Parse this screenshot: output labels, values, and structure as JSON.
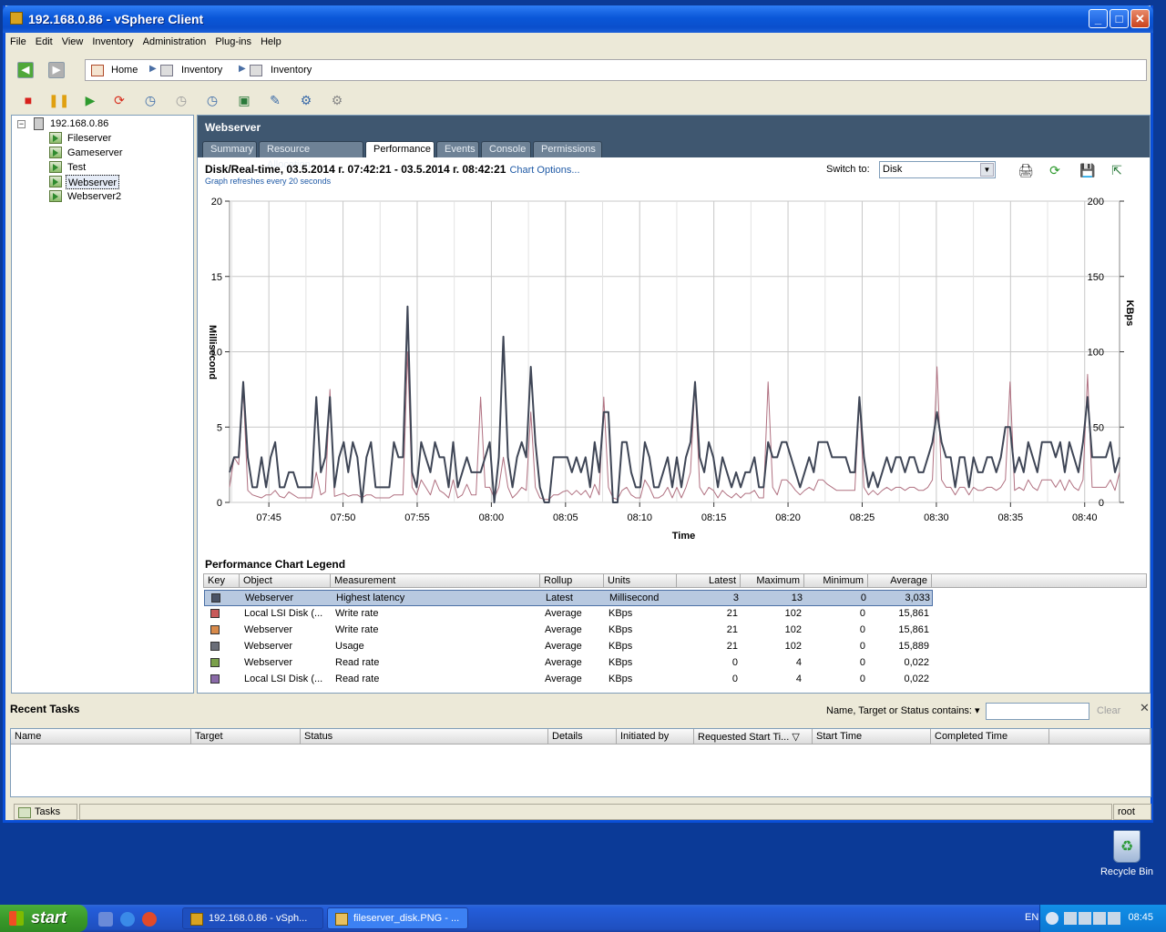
{
  "window": {
    "title": "192.168.0.86 - vSphere Client",
    "min": "_",
    "max": "□",
    "close": "✕"
  },
  "menu": [
    "File",
    "Edit",
    "View",
    "Inventory",
    "Administration",
    "Plug-ins",
    "Help"
  ],
  "breadcrumb": [
    "Home",
    "Inventory",
    "Inventory"
  ],
  "tree": {
    "host": "192.168.0.86",
    "expander": "−",
    "vms": [
      "Fileserver",
      "Gameserver",
      "Test",
      "Webserver",
      "Webserver2"
    ],
    "selected": "Webserver"
  },
  "main": {
    "title": "Webserver",
    "tabs": [
      "Summary",
      "Resource Allocation",
      "Performance",
      "Events",
      "Console",
      "Permissions"
    ],
    "active_tab": "Performance"
  },
  "chart_header": {
    "title": "Disk/Real-time, 03.5.2014 г. 07:42:21 - 03.5.2014 г. 08:42:21",
    "options_link": "Chart Options...",
    "refresh_note": "Graph refreshes every 20 seconds",
    "switch_label": "Switch to:",
    "switch_value": "Disk",
    "switch_arrow": "▼"
  },
  "header_icons": [
    "🖨",
    "⟳",
    "💾",
    "⇱"
  ],
  "chart_data": {
    "type": "line",
    "xlabel": "Time",
    "ylabel_left": "Millisecond",
    "ylabel_right": "KBps",
    "x_ticks": [
      "07:45",
      "07:50",
      "07:55",
      "08:00",
      "08:05",
      "08:10",
      "08:15",
      "08:20",
      "08:25",
      "08:30",
      "08:35",
      "08:40"
    ],
    "y_left_ticks": [
      "0",
      "5",
      "10",
      "15",
      "20"
    ],
    "y_right_ticks": [
      "0",
      "50",
      "100",
      "150",
      "200"
    ],
    "ylim_left": [
      0,
      20
    ],
    "ylim_right": [
      0,
      200
    ],
    "grid": true,
    "series": [
      {
        "name": "Highest latency",
        "axis": "left",
        "color": "#3f4656",
        "values": [
          2,
          3,
          3,
          8,
          3,
          1,
          1,
          3,
          1,
          3,
          4,
          1,
          1,
          2,
          2,
          1,
          1,
          1,
          1,
          7,
          2,
          3,
          7,
          1,
          3,
          4,
          2,
          4,
          3,
          0,
          3,
          4,
          1,
          1,
          1,
          1,
          4,
          3,
          3,
          13,
          2,
          1,
          4,
          3,
          2,
          4,
          3,
          3,
          1,
          4,
          1,
          2,
          3,
          2,
          2,
          2,
          3,
          4,
          0,
          3,
          11,
          3,
          1,
          3,
          4,
          3,
          9,
          4,
          1,
          0,
          0,
          3,
          3,
          3,
          3,
          2,
          3,
          2,
          3,
          1,
          4,
          2,
          6,
          6,
          0,
          0,
          4,
          4,
          2,
          1,
          1,
          4,
          3,
          1,
          1,
          2,
          3,
          1,
          3,
          1,
          3,
          4,
          8,
          3,
          2,
          4,
          3,
          1,
          3,
          2,
          1,
          2,
          1,
          2,
          2,
          3,
          1,
          1,
          4,
          3,
          3,
          4,
          4,
          3,
          2,
          1,
          2,
          3,
          2,
          4,
          4,
          4,
          3,
          3,
          3,
          3,
          2,
          2,
          7,
          3,
          1,
          2,
          1,
          2,
          3,
          2,
          3,
          3,
          2,
          3,
          3,
          2,
          2,
          3,
          4,
          6,
          4,
          3,
          3,
          1,
          3,
          3,
          1,
          3,
          2,
          2,
          3,
          3,
          2,
          3,
          5,
          5,
          2,
          3,
          2,
          4,
          3,
          2,
          4,
          4,
          4,
          3,
          4,
          2,
          4,
          3,
          2,
          4,
          7,
          3,
          3,
          3,
          3,
          4,
          2,
          3
        ]
      },
      {
        "name": "Write rate",
        "axis": "right",
        "color": "#b07080",
        "values": [
          10,
          30,
          25,
          75,
          8,
          5,
          4,
          3,
          5,
          5,
          8,
          4,
          3,
          7,
          5,
          3,
          3,
          3,
          3,
          20,
          5,
          7,
          75,
          4,
          5,
          6,
          4,
          5,
          5,
          3,
          5,
          5,
          3,
          3,
          3,
          3,
          5,
          5,
          5,
          100,
          10,
          5,
          15,
          10,
          5,
          15,
          8,
          6,
          3,
          15,
          3,
          5,
          12,
          5,
          5,
          70,
          10,
          10,
          3,
          10,
          30,
          10,
          3,
          6,
          10,
          8,
          60,
          10,
          3,
          2,
          2,
          5,
          5,
          7,
          8,
          5,
          8,
          5,
          8,
          3,
          12,
          5,
          70,
          10,
          3,
          2,
          8,
          10,
          5,
          3,
          3,
          15,
          10,
          3,
          3,
          5,
          10,
          3,
          10,
          3,
          10,
          20,
          80,
          10,
          5,
          10,
          8,
          3,
          8,
          5,
          3,
          6,
          3,
          6,
          6,
          8,
          3,
          3,
          80,
          10,
          5,
          15,
          15,
          12,
          8,
          5,
          8,
          10,
          8,
          15,
          15,
          12,
          10,
          8,
          8,
          8,
          8,
          8,
          70,
          10,
          5,
          8,
          5,
          8,
          10,
          8,
          10,
          10,
          8,
          10,
          10,
          8,
          8,
          10,
          15,
          90,
          15,
          10,
          10,
          5,
          10,
          10,
          5,
          10,
          8,
          8,
          10,
          10,
          8,
          10,
          15,
          80,
          8,
          10,
          8,
          15,
          10,
          8,
          15,
          15,
          15,
          10,
          15,
          8,
          15,
          10,
          8,
          15,
          85,
          10,
          10,
          10,
          10,
          15,
          8,
          20
        ]
      }
    ]
  },
  "legend": {
    "title": "Performance Chart Legend",
    "columns": [
      "Key",
      "Object",
      "Measurement",
      "Rollup",
      "Units",
      "Latest",
      "Maximum",
      "Minimum",
      "Average"
    ],
    "rows": [
      {
        "color": "#4a5366",
        "object": "Webserver",
        "measurement": "Highest latency",
        "rollup": "Latest",
        "units": "Millisecond",
        "latest": "3",
        "maximum": "13",
        "minimum": "0",
        "average": "3,033"
      },
      {
        "color": "#c85a5a",
        "object": "Local LSI Disk (...",
        "measurement": "Write rate",
        "rollup": "Average",
        "units": "KBps",
        "latest": "21",
        "maximum": "102",
        "minimum": "0",
        "average": "15,861"
      },
      {
        "color": "#d88a4a",
        "object": "Webserver",
        "measurement": "Write rate",
        "rollup": "Average",
        "units": "KBps",
        "latest": "21",
        "maximum": "102",
        "minimum": "0",
        "average": "15,861"
      },
      {
        "color": "#6a6e78",
        "object": "Webserver",
        "measurement": "Usage",
        "rollup": "Average",
        "units": "KBps",
        "latest": "21",
        "maximum": "102",
        "minimum": "0",
        "average": "15,889"
      },
      {
        "color": "#7aa04a",
        "object": "Webserver",
        "measurement": "Read rate",
        "rollup": "Average",
        "units": "KBps",
        "latest": "0",
        "maximum": "4",
        "minimum": "0",
        "average": "0,022"
      },
      {
        "color": "#8a6aa8",
        "object": "Local LSI Disk (...",
        "measurement": "Read rate",
        "rollup": "Average",
        "units": "KBps",
        "latest": "0",
        "maximum": "4",
        "minimum": "0",
        "average": "0,022"
      }
    ]
  },
  "recent_tasks": {
    "title": "Recent Tasks",
    "filter_label": "Name, Target or Status contains: ▾",
    "filter_value": "",
    "clear": "Clear",
    "close": "✕",
    "columns": [
      "Name",
      "Target",
      "Status",
      "Details",
      "Initiated by",
      "Requested Start Ti... ▽",
      "Start Time",
      "Completed Time"
    ]
  },
  "statusbar": {
    "tasks": "Tasks",
    "user": "root"
  },
  "desktop": {
    "recycle_bin": "Recycle Bin"
  },
  "taskbar": {
    "start": "start",
    "buttons": [
      "192.168.0.86 - vSph...",
      "fileserver_disk.PNG - ..."
    ],
    "lang": "EN",
    "clock": "08:45"
  }
}
